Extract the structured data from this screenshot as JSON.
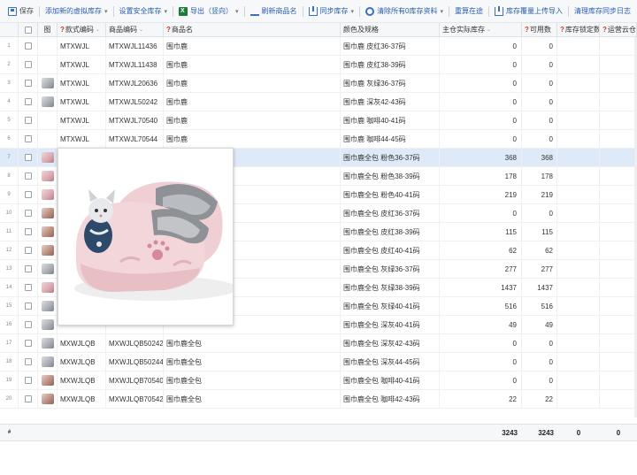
{
  "toolbar": {
    "items": [
      {
        "label": "保存",
        "icon": "save-icon"
      },
      {
        "label": "添加新的虚拟库存",
        "caret": "▾"
      },
      {
        "label": "设置安全库存",
        "caret": "▾"
      },
      {
        "label": "导出（竖向）",
        "icon": "excel-icon",
        "caret": "▾"
      },
      {
        "label": "刷新商品名",
        "icon": "refresh-icon"
      },
      {
        "label": "同步库存",
        "icon": "sync-icon",
        "caret": "▾"
      },
      {
        "label": "清除所有0库存资料",
        "icon": "link-icon",
        "caret": "▾"
      },
      {
        "label": "重算在途"
      },
      {
        "label": "库存覆量上传导入",
        "icon": "upload-icon"
      },
      {
        "label": "清理库存同步日志"
      }
    ]
  },
  "grid": {
    "columns": {
      "img": "图",
      "style": "款式编码",
      "code": "商品编码",
      "name": "商品名",
      "color": "颜色及规格",
      "stock": "主仓实际库存",
      "avail": "可用数",
      "lock": "库存锁定数",
      "ship": "运营云仓可"
    },
    "sort_glyph": "⌄",
    "qmark": "?",
    "rows": [
      {
        "idx": "1",
        "img": "",
        "style": "MTXWJL",
        "code": "MTXWJL11436",
        "name": "围巾鹿",
        "color": "围巾鹿 皮红36-37码",
        "stock": "0",
        "avail": "0"
      },
      {
        "idx": "2",
        "img": "",
        "style": "MTXWJL",
        "code": "MTXWJL11438",
        "name": "围巾鹿",
        "color": "围巾鹿 皮红38-39码",
        "stock": "0",
        "avail": "0"
      },
      {
        "idx": "3",
        "img": "gray",
        "style": "MTXWJL",
        "code": "MTXWJL20636",
        "name": "围巾鹿",
        "color": "围巾鹿 灰绿36-37码",
        "stock": "0",
        "avail": "0"
      },
      {
        "idx": "4",
        "img": "gray",
        "style": "MTXWJL",
        "code": "MTXWJL50242",
        "name": "围巾鹿",
        "color": "围巾鹿 深灰42-43码",
        "stock": "0",
        "avail": "0"
      },
      {
        "idx": "5",
        "img": "",
        "style": "MTXWJL",
        "code": "MTXWJL70540",
        "name": "围巾鹿",
        "color": "围巾鹿 咖啡40-41码",
        "stock": "0",
        "avail": "0"
      },
      {
        "idx": "6",
        "img": "",
        "style": "MTXWJL",
        "code": "MTXWJL70544",
        "name": "围巾鹿",
        "color": "围巾鹿 咖啡44-45码",
        "stock": "0",
        "avail": "0"
      },
      {
        "idx": "7",
        "img": "pink",
        "style": "",
        "code": "",
        "name": "",
        "color": "围巾鹿全包 粉色36-37码",
        "stock": "368",
        "avail": "368"
      },
      {
        "idx": "8",
        "img": "pink",
        "style": "",
        "code": "",
        "name": "",
        "color": "围巾鹿全包 粉色38-39码",
        "stock": "178",
        "avail": "178"
      },
      {
        "idx": "9",
        "img": "pink",
        "style": "",
        "code": "",
        "name": "",
        "color": "围巾鹿全包 粉色40-41码",
        "stock": "219",
        "avail": "219"
      },
      {
        "idx": "10",
        "img": "brown",
        "style": "",
        "code": "",
        "name": "",
        "color": "围巾鹿全包 皮红36-37码",
        "stock": "0",
        "avail": "0"
      },
      {
        "idx": "11",
        "img": "brown",
        "style": "",
        "code": "",
        "name": "",
        "color": "围巾鹿全包 皮红38-39码",
        "stock": "115",
        "avail": "115"
      },
      {
        "idx": "12",
        "img": "brown",
        "style": "",
        "code": "",
        "name": "",
        "color": "围巾鹿全包 皮红40-41码",
        "stock": "62",
        "avail": "62"
      },
      {
        "idx": "13",
        "img": "gray",
        "style": "",
        "code": "",
        "name": "",
        "color": "围巾鹿全包 灰绿36-37码",
        "stock": "277",
        "avail": "277"
      },
      {
        "idx": "14",
        "img": "pink",
        "style": "",
        "code": "",
        "name": "",
        "color": "围巾鹿全包 灰绿38-39码",
        "stock": "1437",
        "avail": "1437"
      },
      {
        "idx": "15",
        "img": "gray",
        "style": "",
        "code": "",
        "name": "",
        "color": "围巾鹿全包 灰绿40-41码",
        "stock": "516",
        "avail": "516"
      },
      {
        "idx": "16",
        "img": "gray",
        "style": "",
        "code": "",
        "name": "",
        "color": "围巾鹿全包 深灰40-41码",
        "stock": "49",
        "avail": "49"
      },
      {
        "idx": "17",
        "img": "gray",
        "style": "MXWJLQB",
        "code": "MXWJLQB50242",
        "name": "围巾鹿全包",
        "color": "围巾鹿全包 深灰42-43码",
        "stock": "0",
        "avail": "0"
      },
      {
        "idx": "18",
        "img": "gray",
        "style": "MXWJLQB",
        "code": "MXWJLQB50244",
        "name": "围巾鹿全包",
        "color": "围巾鹿全包 深灰44-45码",
        "stock": "0",
        "avail": "0"
      },
      {
        "idx": "19",
        "img": "brown",
        "style": "MXWJLQB",
        "code": "MXWJLQB70540",
        "name": "围巾鹿全包",
        "color": "围巾鹿全包 咖啡40-41码",
        "stock": "0",
        "avail": "0"
      },
      {
        "idx": "20",
        "img": "brown",
        "style": "MXWJLQB",
        "code": "MXWJLQB70542",
        "name": "围巾鹿全包",
        "color": "围巾鹿全包 咖啡42-43码",
        "stock": "22",
        "avail": "22"
      }
    ],
    "selected_row": "7",
    "footer": {
      "idx": "#",
      "stock": "3243",
      "avail": "3243",
      "lock": "0",
      "ship": "0"
    }
  },
  "preview": {
    "product": "pink-cat-slipper",
    "colors": {
      "base": "#f0d2d6",
      "fur": "#8e9196",
      "cat": "#2d4a6b"
    }
  }
}
